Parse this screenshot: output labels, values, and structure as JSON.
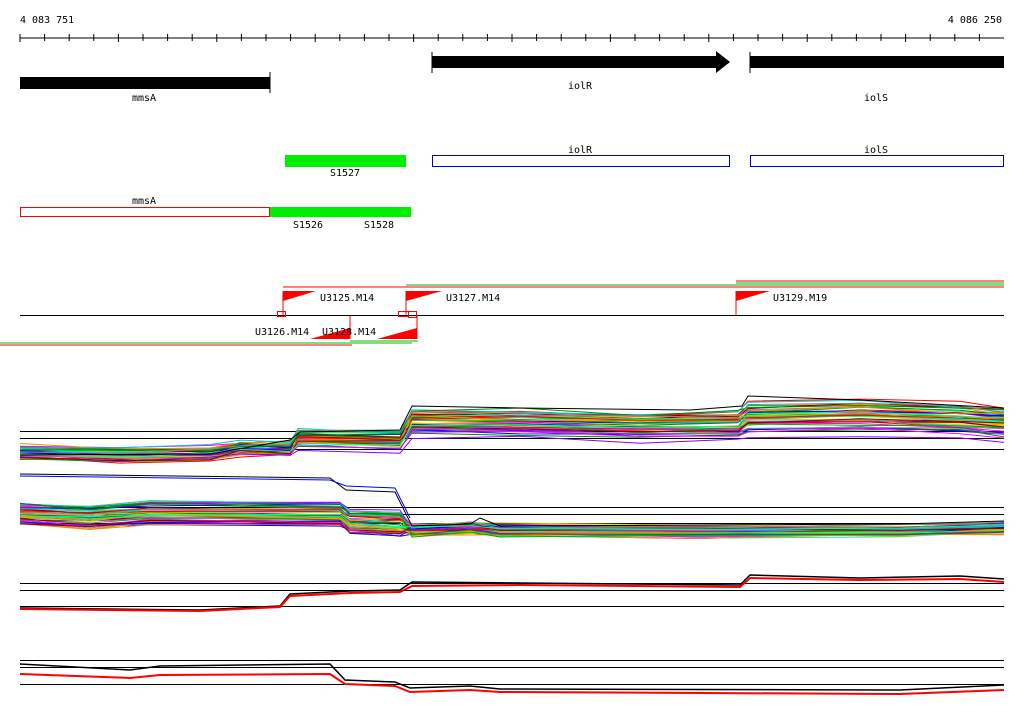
{
  "coordinates": {
    "start_label": "4 083 751",
    "end_label": "4 086 250"
  },
  "genes": [
    {
      "name": "mmsA",
      "strand": "-",
      "label": "mmsA"
    },
    {
      "name": "iolR",
      "strand": "+",
      "label": "iolR"
    },
    {
      "name": "iolS",
      "strand": "+",
      "label": "iolS"
    }
  ],
  "annotations": {
    "open_features": [
      {
        "label": "iolR",
        "color": "#0000cc"
      },
      {
        "label": "iolS",
        "color": "#0000cc"
      },
      {
        "label": "mmsA",
        "color": "#ff0000"
      }
    ],
    "segments": [
      {
        "label": "S1527"
      },
      {
        "label": "S1526"
      },
      {
        "label": "S1528"
      }
    ]
  },
  "promoters": [
    {
      "label": "U3125.M14"
    },
    {
      "label": "U3127.M14"
    },
    {
      "label": "U3129.M19"
    },
    {
      "label": "U3126.M14"
    },
    {
      "label": "U3128.M14"
    }
  ],
  "colors": {
    "gene_fill": "#000000",
    "segment_fill": "#00ee00",
    "plus_feature": "#0000cc",
    "minus_feature": "#ff0000",
    "promoter_flag": "#ff0000",
    "axis": "#000000",
    "expression_palette": [
      "#ff0000",
      "#00aa00",
      "#0000ff",
      "#ff00ff",
      "#00cccc",
      "#cccc00",
      "#ff8800",
      "#8800ff",
      "#008800",
      "#880000",
      "#888888",
      "#00ff88"
    ]
  }
}
